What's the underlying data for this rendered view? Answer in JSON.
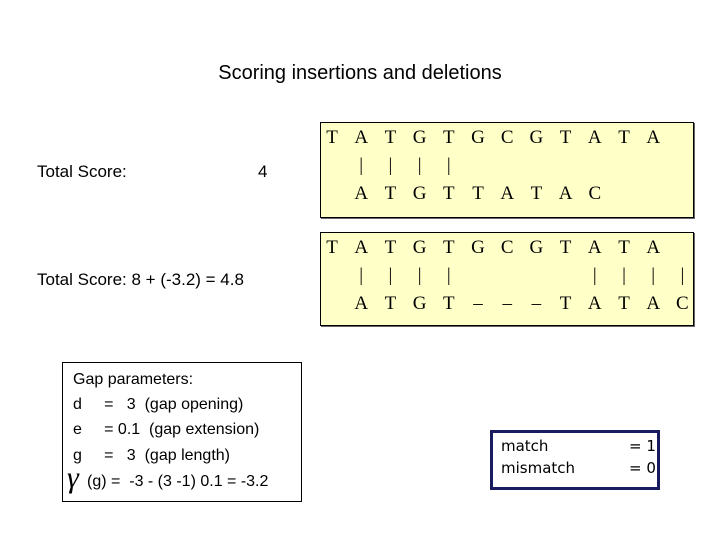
{
  "title": "Scoring insertions and deletions",
  "score1": {
    "label": "Total Score:",
    "value": "4"
  },
  "score2": {
    "label": "Total Score: 8 + (-3.2) = 4.8"
  },
  "alignment1": {
    "top": "TATGTGCGTATA",
    "mid": " |||| ",
    "bottom": " ATGTTATAC"
  },
  "alignment2": {
    "top": "TATGTGCGTATA",
    "mid": " ||||    ||||",
    "bottom": " ATGT---TATAC"
  },
  "gap_params": {
    "heading": "Gap parameters:",
    "lines": [
      "d     =   3  (gap opening)",
      "e     = 0.1  (gap extension)",
      "g     =   3  (gap length)"
    ],
    "gamma_symbol": "γ",
    "formula": "(g) =  -3 - (3 -1) 0.1 = -3.2"
  },
  "scoring": {
    "match_label": "match",
    "match_value": "= 1",
    "mismatch_label": "mismatch",
    "mismatch_value": "= 0"
  }
}
